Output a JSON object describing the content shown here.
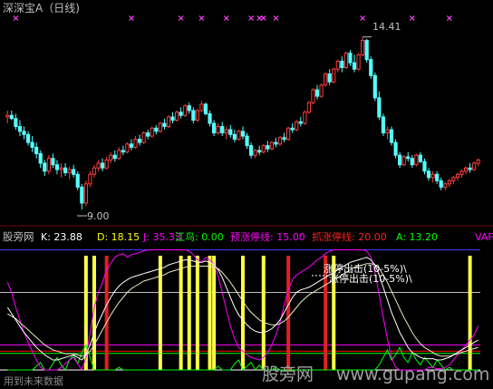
{
  "window": {
    "title": "深深宝A（日线)"
  },
  "colors": {
    "bg": "#000000",
    "up": "#ff3c3c",
    "down": "#54ffff",
    "k": "#ffffff",
    "d": "#ffff00",
    "j": "#ff00ff",
    "jiangniao": "#00ff00",
    "yuzhang": "#ff00ff",
    "zhua": "#ff0000",
    "a": "#00ff00",
    "hline_blue": "#3c3cff",
    "hline_pink": "#ff66cc",
    "hline_gray": "#bdbdbd",
    "bar_yellow": "#ffff44",
    "bar_red": "#e02020",
    "text_gray": "#c0c0c0"
  },
  "chart_data": [
    {
      "type": "candlestick",
      "title": "深深宝A（日线)",
      "ylim": [
        8.6,
        15.0
      ],
      "annotations": {
        "high_label": "14.41",
        "high_value": 14.41,
        "low_label": "9.00",
        "low_value": 9.0
      },
      "candles": [
        [
          11.9,
          12.1,
          11.7,
          11.95
        ],
        [
          11.95,
          12.1,
          11.8,
          11.85
        ],
        [
          11.85,
          12.0,
          11.5,
          11.6
        ],
        [
          11.6,
          11.8,
          11.3,
          11.45
        ],
        [
          11.45,
          11.6,
          11.2,
          11.35
        ],
        [
          11.35,
          11.45,
          11.0,
          11.1
        ],
        [
          11.1,
          11.3,
          10.8,
          10.95
        ],
        [
          10.95,
          11.1,
          10.6,
          10.75
        ],
        [
          10.75,
          10.85,
          10.3,
          10.45
        ],
        [
          10.45,
          10.55,
          10.05,
          10.2
        ],
        [
          10.2,
          10.7,
          10.1,
          10.6
        ],
        [
          10.6,
          10.75,
          10.3,
          10.4
        ],
        [
          10.4,
          10.55,
          10.1,
          10.25
        ],
        [
          10.25,
          10.45,
          10.0,
          10.3
        ],
        [
          10.3,
          10.45,
          10.05,
          10.15
        ],
        [
          10.15,
          10.35,
          9.95,
          10.25
        ],
        [
          10.25,
          10.4,
          10.0,
          10.1
        ],
        [
          10.1,
          10.2,
          9.6,
          9.7
        ],
        [
          9.7,
          9.8,
          9.0,
          9.2
        ],
        [
          9.2,
          9.9,
          9.1,
          9.8
        ],
        [
          9.8,
          10.2,
          9.7,
          10.1
        ],
        [
          10.1,
          10.4,
          10.0,
          10.3
        ],
        [
          10.3,
          10.55,
          10.2,
          10.45
        ],
        [
          10.45,
          10.6,
          10.2,
          10.3
        ],
        [
          10.3,
          10.65,
          10.25,
          10.55
        ],
        [
          10.55,
          10.8,
          10.45,
          10.7
        ],
        [
          10.7,
          10.85,
          10.5,
          10.6
        ],
        [
          10.6,
          10.95,
          10.55,
          10.85
        ],
        [
          10.85,
          11.0,
          10.7,
          10.8
        ],
        [
          10.8,
          11.1,
          10.75,
          11.05
        ],
        [
          11.05,
          11.2,
          10.85,
          10.95
        ],
        [
          10.95,
          11.3,
          10.9,
          11.2
        ],
        [
          11.2,
          11.35,
          11.0,
          11.1
        ],
        [
          11.1,
          11.45,
          11.05,
          11.4
        ],
        [
          11.4,
          11.5,
          11.2,
          11.3
        ],
        [
          11.3,
          11.6,
          11.25,
          11.55
        ],
        [
          11.55,
          11.65,
          11.35,
          11.45
        ],
        [
          11.45,
          11.75,
          11.4,
          11.7
        ],
        [
          11.7,
          11.85,
          11.5,
          11.6
        ],
        [
          11.6,
          11.95,
          11.55,
          11.9
        ],
        [
          11.9,
          12.05,
          11.7,
          11.8
        ],
        [
          11.8,
          12.1,
          11.75,
          12.05
        ],
        [
          12.05,
          12.2,
          11.85,
          11.95
        ],
        [
          11.95,
          12.3,
          11.9,
          12.25
        ],
        [
          12.25,
          12.35,
          12.0,
          12.1
        ],
        [
          12.1,
          12.2,
          11.7,
          11.8
        ],
        [
          11.8,
          12.15,
          11.75,
          12.1
        ],
        [
          12.1,
          12.4,
          12.05,
          12.3
        ],
        [
          12.3,
          12.35,
          11.95,
          12.0
        ],
        [
          12.0,
          12.1,
          11.6,
          11.7
        ],
        [
          11.7,
          11.8,
          11.3,
          11.4
        ],
        [
          11.4,
          11.7,
          11.35,
          11.6
        ],
        [
          11.6,
          11.75,
          11.3,
          11.4
        ],
        [
          11.4,
          11.6,
          11.2,
          11.5
        ],
        [
          11.5,
          11.65,
          11.25,
          11.35
        ],
        [
          11.35,
          11.5,
          11.1,
          11.2
        ],
        [
          11.2,
          11.5,
          11.15,
          11.45
        ],
        [
          11.45,
          11.6,
          11.2,
          11.3
        ],
        [
          11.3,
          11.4,
          10.9,
          11.0
        ],
        [
          11.0,
          11.1,
          10.6,
          10.7
        ],
        [
          10.7,
          10.9,
          10.6,
          10.85
        ],
        [
          10.85,
          11.0,
          10.7,
          10.8
        ],
        [
          10.8,
          11.05,
          10.75,
          11.0
        ],
        [
          11.0,
          11.15,
          10.8,
          10.9
        ],
        [
          10.9,
          11.15,
          10.85,
          11.1
        ],
        [
          11.1,
          11.25,
          10.95,
          11.05
        ],
        [
          11.05,
          11.3,
          11.0,
          11.25
        ],
        [
          11.25,
          11.4,
          11.1,
          11.2
        ],
        [
          11.2,
          11.6,
          11.15,
          11.55
        ],
        [
          11.55,
          11.7,
          11.4,
          11.5
        ],
        [
          11.5,
          11.8,
          11.45,
          11.75
        ],
        [
          11.75,
          11.9,
          11.6,
          11.7
        ],
        [
          11.7,
          12.1,
          11.65,
          12.05
        ],
        [
          12.05,
          12.4,
          12.0,
          12.35
        ],
        [
          12.35,
          12.8,
          12.3,
          12.75
        ],
        [
          12.75,
          12.9,
          12.45,
          12.55
        ],
        [
          12.55,
          12.95,
          12.5,
          12.9
        ],
        [
          12.9,
          13.3,
          12.85,
          13.25
        ],
        [
          13.25,
          13.4,
          12.9,
          13.0
        ],
        [
          13.0,
          13.45,
          12.95,
          13.4
        ],
        [
          13.4,
          13.7,
          13.3,
          13.65
        ],
        [
          13.65,
          13.8,
          13.3,
          13.45
        ],
        [
          13.45,
          13.95,
          13.4,
          13.9
        ],
        [
          13.9,
          14.0,
          13.5,
          13.6
        ],
        [
          13.6,
          13.85,
          13.3,
          13.4
        ],
        [
          13.4,
          13.9,
          13.35,
          13.85
        ],
        [
          13.85,
          14.41,
          13.8,
          14.3
        ],
        [
          14.3,
          14.35,
          13.6,
          13.7
        ],
        [
          13.7,
          13.8,
          13.1,
          13.2
        ],
        [
          13.2,
          13.3,
          12.4,
          12.5
        ],
        [
          12.5,
          12.7,
          11.8,
          11.9
        ],
        [
          11.9,
          12.0,
          11.3,
          11.4
        ],
        [
          11.4,
          11.6,
          11.2,
          11.5
        ],
        [
          11.5,
          11.6,
          11.0,
          11.1
        ],
        [
          11.1,
          11.2,
          10.6,
          10.7
        ],
        [
          10.7,
          10.8,
          10.3,
          10.4
        ],
        [
          10.4,
          10.7,
          10.35,
          10.65
        ],
        [
          10.65,
          10.8,
          10.5,
          10.6
        ],
        [
          10.6,
          10.7,
          10.3,
          10.4
        ],
        [
          10.4,
          10.75,
          10.35,
          10.7
        ],
        [
          10.7,
          10.8,
          10.45,
          10.5
        ],
        [
          10.5,
          10.6,
          10.1,
          10.2
        ],
        [
          10.2,
          10.3,
          9.9,
          10.0
        ],
        [
          10.0,
          10.2,
          9.85,
          10.1
        ],
        [
          10.1,
          10.2,
          9.8,
          9.9
        ],
        [
          9.9,
          10.0,
          9.6,
          9.7
        ],
        [
          9.7,
          9.85,
          9.6,
          9.8
        ],
        [
          9.8,
          9.95,
          9.7,
          9.9
        ],
        [
          9.9,
          10.05,
          9.8,
          10.0
        ],
        [
          10.0,
          10.15,
          9.9,
          10.1
        ],
        [
          10.1,
          10.25,
          10.0,
          10.2
        ],
        [
          10.2,
          10.35,
          10.1,
          10.3
        ],
        [
          10.3,
          10.45,
          10.15,
          10.25
        ],
        [
          10.25,
          10.5,
          10.2,
          10.45
        ],
        [
          10.45,
          10.6,
          10.35,
          10.55
        ]
      ],
      "signal_marker_indices": [
        2,
        30,
        42,
        47,
        53,
        59,
        61,
        62,
        65,
        86,
        98,
        107
      ]
    },
    {
      "type": "line",
      "title": "股旁网",
      "legend": [
        {
          "label": "K: 23.88",
          "color": "#ffffff"
        },
        {
          "label": "D: 18.15",
          "color": "#ffff00"
        },
        {
          "label": "J: 35.33",
          "color": "#ff00ff"
        },
        {
          "label": "江鸟: 0.00",
          "color": "#00ff00"
        },
        {
          "label": "预涨停线: 15.00",
          "color": "#ff00ff"
        },
        {
          "label": "抓涨停线: 20.00",
          "color": "#ff0000"
        },
        {
          "label": "A: 13.20",
          "color": "#00ff00"
        },
        {
          "label": "VAF",
          "color": "#ff00ff"
        }
      ],
      "ylim": [
        0,
        100
      ],
      "hlines": [
        {
          "value": 96,
          "color": "#3c3cff"
        },
        {
          "value": 62,
          "color": "#bdbdbd"
        },
        {
          "value": 20,
          "color": "#ff00ff"
        },
        {
          "value": 15,
          "color": "#ff0000"
        },
        {
          "value": 13.2,
          "color": "#00ff00"
        }
      ],
      "yellow_bar_indices": [
        19,
        21,
        37,
        42,
        44,
        46,
        49,
        50,
        57,
        62,
        79,
        112
      ],
      "red_bar_indices": [
        24,
        68,
        77
      ],
      "annotation": "涨停出击(10-5%)\\",
      "series": {
        "K": [
          50,
          45,
          40,
          35,
          30,
          26,
          22,
          18,
          15,
          12,
          10,
          8,
          8,
          9,
          10,
          11,
          12,
          10,
          8,
          12,
          20,
          30,
          38,
          45,
          52,
          58,
          63,
          67,
          70,
          72,
          74,
          75,
          76,
          77,
          78,
          79,
          80,
          81,
          82,
          84,
          85,
          86,
          87,
          88,
          88,
          87,
          86,
          86,
          87,
          86,
          84,
          80,
          74,
          66,
          58,
          50,
          44,
          40,
          36,
          33,
          31,
          30,
          30,
          31,
          33,
          36,
          40,
          46,
          52,
          58,
          62,
          64,
          65,
          66,
          68,
          70,
          72,
          74,
          76,
          78,
          80,
          82,
          84,
          86,
          87,
          88,
          89,
          90,
          88,
          84,
          76,
          66,
          56,
          46,
          38,
          30,
          24,
          18,
          14,
          12,
          10,
          9,
          9,
          9,
          8,
          8,
          9,
          10,
          12,
          14,
          16,
          18,
          20,
          22,
          23.88
        ],
        "D": [
          45,
          43,
          41,
          38,
          35,
          32,
          29,
          26,
          23,
          20,
          18,
          16,
          15,
          14,
          13,
          13,
          13,
          12,
          11,
          12,
          15,
          20,
          26,
          32,
          38,
          44,
          49,
          54,
          58,
          62,
          65,
          67,
          69,
          71,
          72,
          73,
          74,
          75,
          76,
          78,
          79,
          80,
          81,
          82,
          83,
          83,
          83,
          83,
          83,
          83,
          82,
          81,
          78,
          74,
          70,
          65,
          60,
          55,
          50,
          46,
          43,
          40,
          38,
          37,
          36,
          36,
          37,
          39,
          42,
          46,
          50,
          54,
          57,
          60,
          62,
          64,
          66,
          68,
          70,
          72,
          74,
          76,
          78,
          80,
          82,
          83,
          84,
          85,
          85,
          84,
          81,
          76,
          70,
          63,
          56,
          49,
          42,
          36,
          30,
          25,
          21,
          18,
          16,
          14,
          12,
          11,
          11,
          11,
          12,
          13,
          14,
          15,
          16,
          17,
          18.15
        ],
        "J": [
          70,
          62,
          50,
          40,
          30,
          22,
          15,
          8,
          2,
          0,
          0,
          0,
          0,
          2,
          5,
          8,
          10,
          5,
          0,
          10,
          30,
          50,
          62,
          70,
          80,
          85,
          90,
          92,
          93,
          90,
          92,
          93,
          94,
          95,
          96,
          96,
          96,
          96,
          96,
          96,
          96,
          96,
          96,
          96,
          95,
          92,
          88,
          86,
          90,
          88,
          84,
          75,
          62,
          48,
          35,
          25,
          18,
          15,
          12,
          10,
          9,
          8,
          10,
          14,
          20,
          28,
          38,
          52,
          64,
          72,
          76,
          78,
          80,
          82,
          85,
          88,
          90,
          93,
          95,
          96,
          96,
          96,
          96,
          96,
          96,
          96,
          96,
          95,
          90,
          78,
          60,
          42,
          25,
          10,
          2,
          0,
          0,
          0,
          0,
          0,
          0,
          0,
          2,
          2,
          1,
          1,
          2,
          4,
          8,
          12,
          16,
          20,
          24,
          28,
          35.33
        ],
        "jiangniao": [
          0,
          0,
          0,
          0,
          0,
          0,
          0,
          3,
          6,
          0,
          0,
          5,
          10,
          4,
          0,
          8,
          12,
          5,
          14,
          20,
          10,
          0,
          0,
          0,
          0,
          0,
          0,
          2,
          0,
          0,
          0,
          0,
          0,
          0,
          0,
          0,
          0,
          0,
          0,
          0,
          0,
          0,
          0,
          0,
          0,
          0,
          0,
          0,
          0,
          0,
          0,
          3,
          0,
          0,
          0,
          5,
          8,
          0,
          3,
          6,
          0,
          4,
          0,
          0,
          0,
          2,
          0,
          0,
          0,
          0,
          0,
          0,
          0,
          0,
          0,
          0,
          0,
          0,
          0,
          0,
          0,
          0,
          0,
          0,
          0,
          0,
          0,
          0,
          0,
          0,
          4,
          10,
          16,
          8,
          12,
          18,
          10,
          6,
          14,
          8,
          4,
          10,
          6,
          2,
          8,
          4,
          0,
          2,
          0,
          0,
          0,
          0,
          0,
          0,
          0
        ]
      }
    }
  ],
  "watermark": {
    "left": "用到未来数据",
    "right": "股旁网",
    "url": "www.gupang.com"
  }
}
